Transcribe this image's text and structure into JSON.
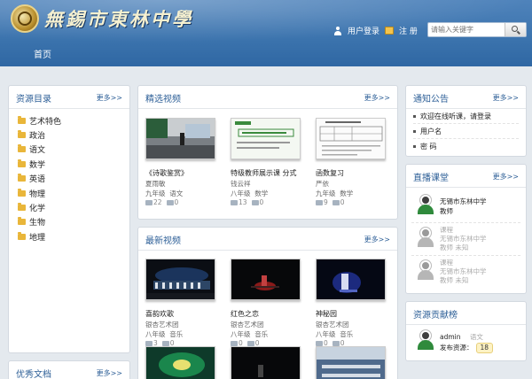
{
  "header": {
    "logo_text": "無錫市東林中學",
    "login_label": "用户登录",
    "register_label": "注 册",
    "search_placeholder": "请输入关键字",
    "nav_home": "首页"
  },
  "left": {
    "resource_title": "资源目录",
    "more": "更多>>",
    "categories": [
      "艺术特色",
      "政治",
      "语文",
      "数学",
      "英语",
      "物理",
      "化学",
      "生物",
      "地理"
    ],
    "docs_title": "优秀文档",
    "docs_more": "更多>>"
  },
  "featured": {
    "title": "精选视频",
    "more": "更多>>",
    "videos": [
      {
        "title": "《诗歌鉴赏》",
        "author": "夏雨敏",
        "grade": "九年级",
        "subject": "语文",
        "views": "22",
        "comments": "0"
      },
      {
        "title": "特级教师展示课   分式",
        "author": "钱云祥",
        "grade": "八年级",
        "subject": "数学",
        "views": "13",
        "comments": "0"
      },
      {
        "title": "函数复习",
        "author": "严依",
        "grade": "九年级",
        "subject": "数学",
        "views": "9",
        "comments": "0"
      }
    ]
  },
  "latest": {
    "title": "最新视频",
    "more": "更多>>",
    "videos": [
      {
        "title": "喜韵欢歌",
        "author": "银杏艺术团",
        "grade": "八年级",
        "subject": "音乐",
        "views": "3",
        "comments": "0"
      },
      {
        "title": "红色之恋",
        "author": "银杏艺术团",
        "grade": "八年级",
        "subject": "音乐",
        "views": "0",
        "comments": "0"
      },
      {
        "title": "神秘园",
        "author": "银杏艺术团",
        "grade": "八年级",
        "subject": "音乐",
        "views": "0",
        "comments": "0"
      }
    ]
  },
  "notice": {
    "title": "通知公告",
    "more": "更多>>",
    "items": [
      "欢迎在线听课，请登录",
      "用户名",
      "密 码"
    ]
  },
  "live": {
    "title": "直播课堂",
    "more": "更多>>",
    "items": [
      {
        "status": "",
        "school": "无锡市东林中学",
        "role": "教师"
      },
      {
        "status": "课程",
        "school": "无锡市东林中学",
        "role": "教师 未知"
      },
      {
        "status": "课程",
        "school": "无锡市东林中学",
        "role": "教师 未知"
      }
    ]
  },
  "rank": {
    "title": "资源贡献榜",
    "user": "admin",
    "user_sub": "语文",
    "label": "发布资源：",
    "count": "18"
  },
  "colors": {
    "header": "#3b73ad",
    "accent": "#2d5f97",
    "folder": "#e9b63a"
  }
}
